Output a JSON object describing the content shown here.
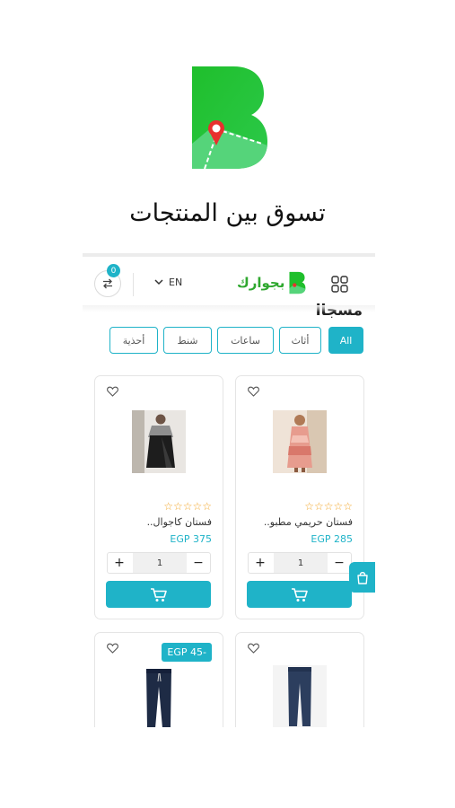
{
  "intro": {
    "headline": "تسوق بين المنتجات"
  },
  "header": {
    "compare_count": "0",
    "language": "EN",
    "brand_name": "بجوارك"
  },
  "section": {
    "title_partial": "مسجاا"
  },
  "tabs": [
    {
      "label": "All",
      "active": true
    },
    {
      "label": "أثاث",
      "active": false
    },
    {
      "label": "ساعات",
      "active": false
    },
    {
      "label": "شنط",
      "active": false
    },
    {
      "label": "أحذية",
      "active": false
    }
  ],
  "products": [
    {
      "name": "فستان حريمي مطبو..",
      "price": "EGP 285",
      "rating": "☆☆☆☆☆",
      "quantity": "1",
      "image": "dress-floral"
    },
    {
      "name": "فستان كاجوال..",
      "price": "EGP 375",
      "rating": "☆☆☆☆☆",
      "quantity": "1",
      "image": "dress-black"
    },
    {
      "name": "",
      "price": "",
      "image": "jeans-dark"
    },
    {
      "name": "",
      "price": "",
      "image": "jeans-drawstring",
      "discount": "EGP 45-"
    }
  ],
  "colors": {
    "accent": "#1fb3c8",
    "brand_green": "#2fa82f",
    "star": "#f2a527"
  }
}
